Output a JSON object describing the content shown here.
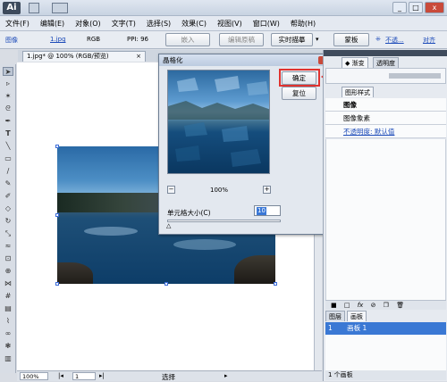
{
  "app": {
    "logo": "Ai"
  },
  "menu": [
    "文件(F)",
    "编辑(E)",
    "对象(O)",
    "文字(T)",
    "选择(S)",
    "效果(C)",
    "视图(V)",
    "窗口(W)",
    "帮助(H)"
  ],
  "control_bar": {
    "label_image": "图像",
    "filename": "1.jpg",
    "color_mode": "RGB",
    "ppi": "PPI: 96",
    "embed": "嵌入",
    "edit_original": "编辑原稿",
    "live_trace": "实时描摹",
    "mask": "蒙板",
    "opacity_label": "不透...",
    "align_label": "对齐"
  },
  "document": {
    "tab": "1.jpg* @ 100% (RGB/预览)",
    "zoom": "100%",
    "page": "1",
    "status": "选择"
  },
  "dialog": {
    "title": "晶格化",
    "ok": "确定",
    "reset": "复位",
    "zoom": "100%",
    "cell_size_label": "单元格大小(C)",
    "cell_size_value": "10"
  },
  "right_panel": {
    "tabs_top": [
      "渐变",
      "透明度"
    ],
    "tabs_style": [
      "图形样式"
    ],
    "rows": [
      "图像",
      "图像象素",
      "不透明度: 默认值"
    ],
    "bottom_tabs": [
      "图层",
      "画板"
    ],
    "artboard_index": "1",
    "artboard_name": "画板 1",
    "artboard_count": "1 个画板"
  }
}
